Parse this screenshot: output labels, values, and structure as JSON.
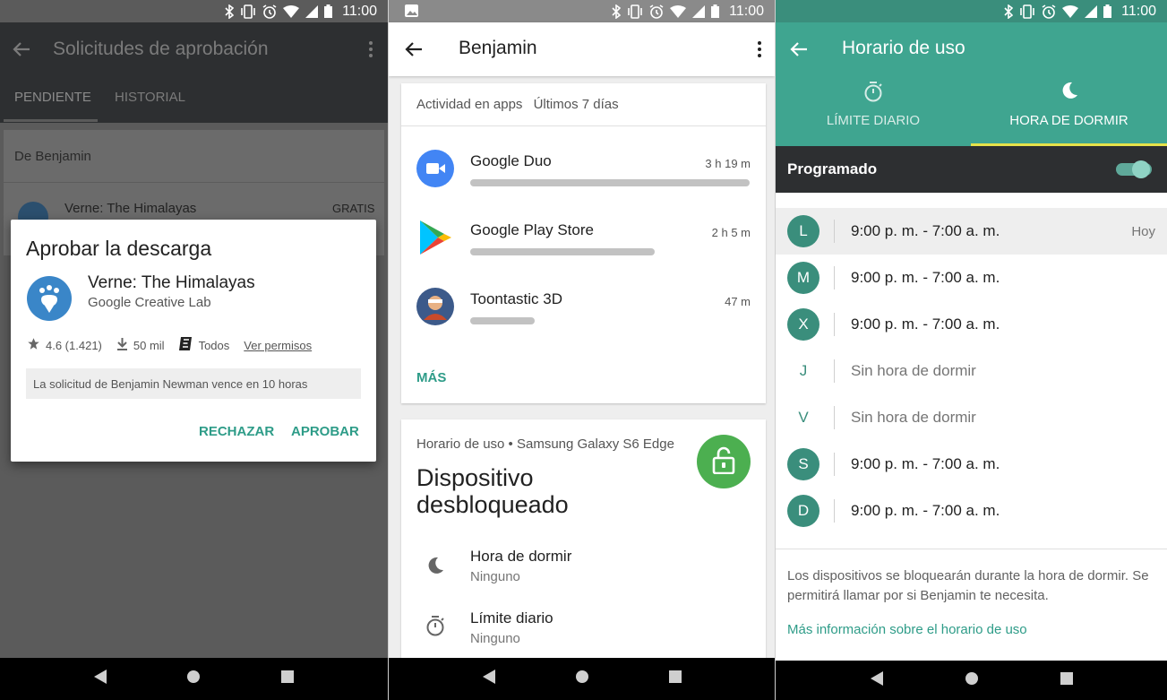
{
  "status": {
    "time": "11:00"
  },
  "approvals": {
    "title": "Solicitudes de aprobación",
    "tabs": [
      "PENDIENTE",
      "HISTORIAL"
    ],
    "section_header": "De Benjamin",
    "list_item": {
      "name": "Verne: The Himalayas",
      "price": "GRATIS"
    },
    "dialog": {
      "title": "Aprobar la descarga",
      "app_name": "Verne: The Himalayas",
      "developer": "Google Creative Lab",
      "rating": "4.6 (1.421)",
      "downloads": "50 mil",
      "content_rating": "Todos",
      "permissions_link": "Ver permisos",
      "notice": "La solicitud de Benjamin Newman vence en 10 horas",
      "reject": "RECHAZAR",
      "approve": "APROBAR"
    }
  },
  "profile": {
    "name": "Benjamin",
    "activity": {
      "title": "Actividad en apps",
      "range": "Últimos 7 días",
      "apps": [
        {
          "name": "Google Duo",
          "time": "3 h 19 m",
          "usage_fraction": 1.0
        },
        {
          "name": "Google Play Store",
          "time": "2 h 5 m",
          "usage_fraction": 0.66
        },
        {
          "name": "Toontastic 3D",
          "time": "47 m",
          "usage_fraction": 0.23
        }
      ],
      "more": "MÁS"
    },
    "device": {
      "subtitle": "Horario de uso • Samsung Galaxy S6 Edge",
      "status_line1": "Dispositivo",
      "status_line2": "desbloqueado",
      "bedtime_label": "Hora de dormir",
      "bedtime_value": "Ninguno",
      "daily_label": "Límite diario",
      "daily_value": "Ninguno"
    }
  },
  "schedule": {
    "title": "Horario de uso",
    "tabs": [
      "LÍMITE DIARIO",
      "HORA DE DORMIR"
    ],
    "scheduled_label": "Programado",
    "days": [
      {
        "letter": "L",
        "text": "9:00 p. m. - 7:00 a. m.",
        "tag": "Hoy",
        "active": true
      },
      {
        "letter": "M",
        "text": "9:00 p. m. - 7:00 a. m.",
        "tag": "",
        "active": true
      },
      {
        "letter": "X",
        "text": "9:00 p. m. - 7:00 a. m.",
        "tag": "",
        "active": true
      },
      {
        "letter": "J",
        "text": "Sin hora de dormir",
        "tag": "",
        "active": false
      },
      {
        "letter": "V",
        "text": "Sin hora de dormir",
        "tag": "",
        "active": false
      },
      {
        "letter": "S",
        "text": "9:00 p. m. - 7:00 a. m.",
        "tag": "",
        "active": true
      },
      {
        "letter": "D",
        "text": "9:00 p. m. - 7:00 a. m.",
        "tag": "",
        "active": true
      }
    ],
    "info": "Los dispositivos se bloquearán durante la hora de dormir. Se permitirá llamar por si Benjamin te necesita.",
    "link": "Más información sobre el horario de uso"
  },
  "colors": {
    "accent": "#3fa590",
    "dark": "#2d2f31",
    "lock_green": "#4caf50"
  }
}
